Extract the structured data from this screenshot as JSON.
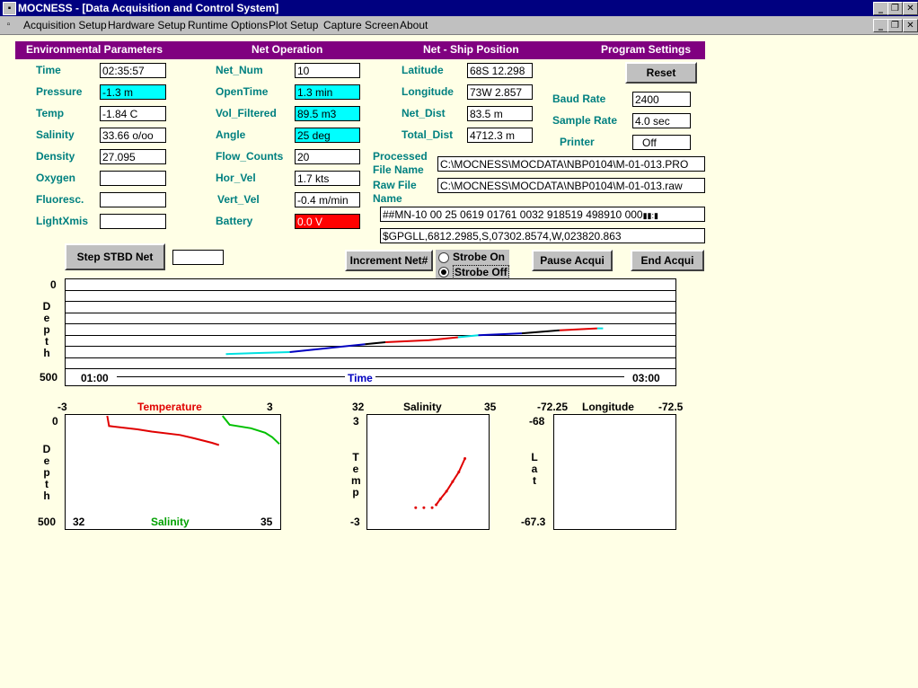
{
  "window": {
    "title": "MOCNESS - [Data Acquisition and Control System]"
  },
  "menu": [
    "Acquisition Setup",
    "Hardware Setup",
    "Runtime Options",
    "Plot Setup",
    "Capture Screen",
    "About"
  ],
  "headers": {
    "env": "Environmental Parameters",
    "net": "Net Operation",
    "pos": "Net - Ship Position",
    "prog": "Program Settings"
  },
  "env": {
    "time": {
      "label": "Time",
      "value": "02:35:57"
    },
    "pressure": {
      "label": "Pressure",
      "value": "-1.3 m"
    },
    "temp": {
      "label": "Temp",
      "value": "-1.84 C"
    },
    "salinity": {
      "label": "Salinity",
      "value": "33.66 o/oo"
    },
    "density": {
      "label": "Density",
      "value": "27.095"
    },
    "oxygen": {
      "label": "Oxygen",
      "value": ""
    },
    "fluoresc": {
      "label": "Fluoresc.",
      "value": ""
    },
    "lightxmis": {
      "label": "LightXmis",
      "value": ""
    }
  },
  "net": {
    "net_num": {
      "label": "Net_Num",
      "value": "10"
    },
    "opentime": {
      "label": "OpenTime",
      "value": "1.3 min"
    },
    "vol_filtered": {
      "label": "Vol_Filtered",
      "value": "89.5 m3"
    },
    "angle": {
      "label": "Angle",
      "value": "25 deg"
    },
    "flow_counts": {
      "label": "Flow_Counts",
      "value": "20"
    },
    "hor_vel": {
      "label": "Hor_Vel",
      "value": "1.7 kts"
    },
    "vert_vel": {
      "label": "Vert_Vel",
      "value": "-0.4 m/min"
    },
    "battery": {
      "label": "Battery",
      "value": "0.0 V"
    }
  },
  "pos": {
    "latitude": {
      "label": "Latitude",
      "value": "68S 12.298"
    },
    "longitude": {
      "label": "Longitude",
      "value": "73W 2.857"
    },
    "net_dist": {
      "label": "Net_Dist",
      "value": "83.5 m"
    },
    "total_dist": {
      "label": "Total_Dist",
      "value": "4712.3 m"
    }
  },
  "prog": {
    "reset": "Reset",
    "baud_rate": {
      "label": "Baud Rate",
      "value": "2400"
    },
    "sample_rate": {
      "label": "Sample Rate",
      "value": "4.0 sec"
    },
    "printer": {
      "label": "Printer",
      "value": "Off"
    }
  },
  "files": {
    "processed_label_1": "Processed",
    "processed_label_2": "File Name",
    "processed_value": "C:\\MOCNESS\\MOCDATA\\NBP0104\\M-01-013.PRO",
    "raw_label_1": "Raw File",
    "raw_label_2": "Name",
    "raw_value": "C:\\MOCNESS\\MOCDATA\\NBP0104\\M-01-013.raw",
    "data_string": "##MN-10 00 25 0619 01761 0032 918519 498910 000",
    "gps_string": "$GPGLL,6812.2985,S,07302.8574,W,023820.863"
  },
  "controls": {
    "step_stbd": "Step STBD Net",
    "step_value": "",
    "increment": "Increment Net#",
    "strobe_on": "Strobe On",
    "strobe_off": "Strobe Off",
    "strobe_selected": "Strobe Off",
    "pause": "Pause Acqui",
    "end": "End Acqui"
  },
  "colors": {
    "title": "#000080",
    "header": "#800080",
    "label": "#008080",
    "highlight": "#00ffff",
    "alarm": "#ff0000",
    "background": "#ffffe6"
  },
  "chart_data": [
    {
      "type": "line",
      "name": "depth_vs_time",
      "ylabel": "Depth",
      "xlabel": "Time",
      "ylim": [
        500,
        0
      ],
      "y_ticks": [
        "0",
        "500"
      ],
      "x_ticks": [
        "01:00",
        "03:00"
      ],
      "grid": true,
      "segments": [
        {
          "color": "#00e0e0",
          "points": [
            [
              1.5,
              360
            ],
            [
              1.6,
              355
            ],
            [
              1.72,
              350
            ]
          ]
        },
        {
          "color": "#0000c0",
          "points": [
            [
              1.72,
              350
            ],
            [
              1.85,
              330
            ],
            [
              1.98,
              310
            ]
          ]
        },
        {
          "color": "#000000",
          "points": [
            [
              1.98,
              310
            ],
            [
              2.05,
              300
            ]
          ]
        },
        {
          "color": "#e00000",
          "points": [
            [
              2.05,
              300
            ],
            [
              2.2,
              290
            ],
            [
              2.3,
              275
            ]
          ]
        },
        {
          "color": "#00e0e0",
          "points": [
            [
              2.3,
              275
            ],
            [
              2.37,
              265
            ]
          ]
        },
        {
          "color": "#0000c0",
          "points": [
            [
              2.37,
              265
            ],
            [
              2.52,
              255
            ]
          ]
        },
        {
          "color": "#000000",
          "points": [
            [
              2.52,
              255
            ],
            [
              2.65,
              240
            ]
          ]
        },
        {
          "color": "#e00000",
          "points": [
            [
              2.65,
              240
            ],
            [
              2.78,
              230
            ]
          ]
        },
        {
          "color": "#00e0e0",
          "points": [
            [
              2.78,
              230
            ],
            [
              2.8,
              230
            ]
          ]
        }
      ]
    },
    {
      "type": "line",
      "name": "temp_sal_profile",
      "ylabel": "Depth",
      "series": [
        {
          "name": "Temperature",
          "color": "#e00000",
          "xlim": [
            -3,
            3
          ],
          "points": [
            [
              -1.85,
              0
            ],
            [
              -1.8,
              45
            ],
            [
              -1.0,
              60
            ],
            [
              -0.6,
              70
            ],
            [
              0.2,
              85
            ],
            [
              0.6,
              100
            ],
            [
              1.1,
              120
            ],
            [
              1.3,
              130
            ]
          ]
        },
        {
          "name": "Salinity",
          "color": "#00c000",
          "xlim": [
            32,
            35
          ],
          "points": [
            [
              34.2,
              0
            ],
            [
              34.3,
              40
            ],
            [
              34.6,
              55
            ],
            [
              34.8,
              75
            ],
            [
              34.9,
              95
            ],
            [
              35.0,
              125
            ]
          ]
        }
      ],
      "ylim": [
        500,
        0
      ],
      "top_ticks": [
        "-3",
        "3"
      ],
      "bottom_ticks": [
        "32",
        "35"
      ],
      "y_ticks": [
        "0",
        "500"
      ]
    },
    {
      "type": "scatter",
      "name": "ts_diagram",
      "title": "Salinity",
      "ylabel": "Temp",
      "xlim": [
        32,
        35
      ],
      "ylim": [
        -3,
        3
      ],
      "x_ticks": [
        "32",
        "35"
      ],
      "y_ticks": [
        "3",
        "-3"
      ],
      "points": [
        [
          33.2,
          -1.85
        ],
        [
          33.4,
          -1.85
        ],
        [
          33.6,
          -1.85
        ],
        [
          33.7,
          -1.7
        ],
        [
          33.8,
          -1.4
        ],
        [
          33.95,
          -1.0
        ],
        [
          34.1,
          -0.5
        ],
        [
          34.25,
          0.0
        ],
        [
          34.4,
          0.7
        ]
      ]
    },
    {
      "type": "scatter",
      "name": "position",
      "title": "Longitude",
      "ylabel": "Lat",
      "xlim": [
        -72.25,
        -72.5
      ],
      "ylim": [
        -68,
        -67.3
      ],
      "x_ticks": [
        "-72.25",
        "-72.5"
      ],
      "y_ticks": [
        "-68",
        "-67.3"
      ],
      "points": []
    }
  ]
}
